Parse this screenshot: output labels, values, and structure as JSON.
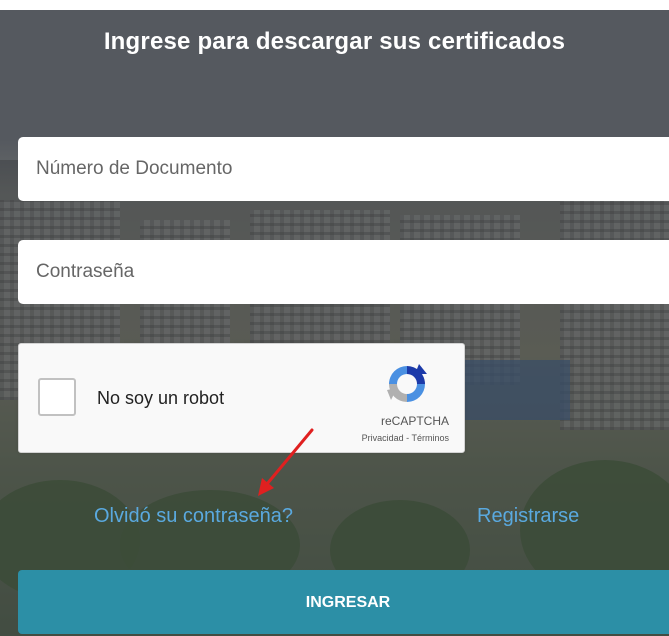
{
  "header": {
    "title": "Ingrese para descargar sus certificados"
  },
  "form": {
    "document_placeholder": "Número de Documento",
    "password_placeholder": "Contraseña"
  },
  "captcha": {
    "label": "No soy un robot",
    "brand": "reCAPTCHA",
    "links": "Privacidad - Términos",
    "icon": "recaptcha-icon"
  },
  "links": {
    "forgot": "Olvidó su contraseña?",
    "register": "Registrarse"
  },
  "submit": {
    "label": "INGRESAR"
  },
  "colors": {
    "button": "#2c8fa6",
    "link": "#5aa9df",
    "arrow": "#e02020"
  }
}
